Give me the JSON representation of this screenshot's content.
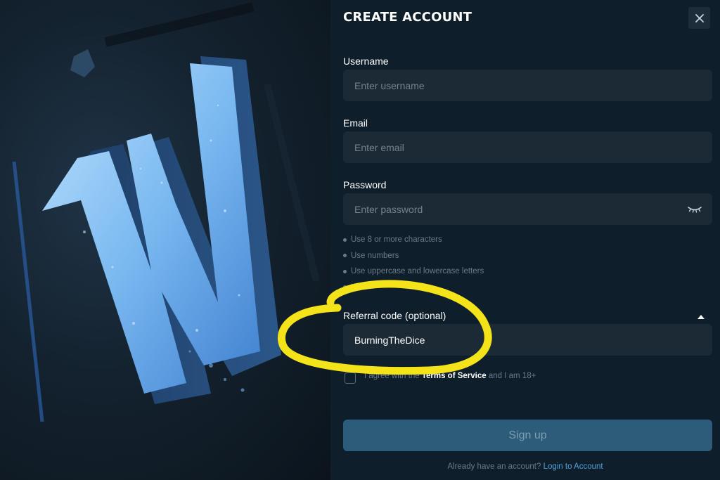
{
  "form": {
    "title": "CREATE ACCOUNT",
    "close_icon": "close-icon",
    "username": {
      "label": "Username",
      "placeholder": "Enter username",
      "value": ""
    },
    "email": {
      "label": "Email",
      "placeholder": "Enter email",
      "value": ""
    },
    "password": {
      "label": "Password",
      "placeholder": "Enter password",
      "value": "",
      "toggle_icon": "eye-closed-icon"
    },
    "password_rules": [
      "Use 8 or more characters",
      "Use numbers",
      "Use uppercase and lowercase letters",
      "Use"
    ],
    "referral": {
      "label": "Referral code (optional)",
      "value": "BurningTheDice",
      "toggle_icon": "caret-up-icon"
    },
    "agree": {
      "prefix": "I agree with the ",
      "tos_link": "Terms of Service",
      "suffix": " and I am 18+",
      "checked": false
    },
    "signup_button": "Sign up",
    "login_prompt": "Already have an account? ",
    "login_link": "Login to Account"
  },
  "colors": {
    "background": "#0e1e2a",
    "field": "#1b2a35",
    "button": "#2d5b7a",
    "link": "#4fa3dc",
    "annotation": "#f5e31a"
  }
}
